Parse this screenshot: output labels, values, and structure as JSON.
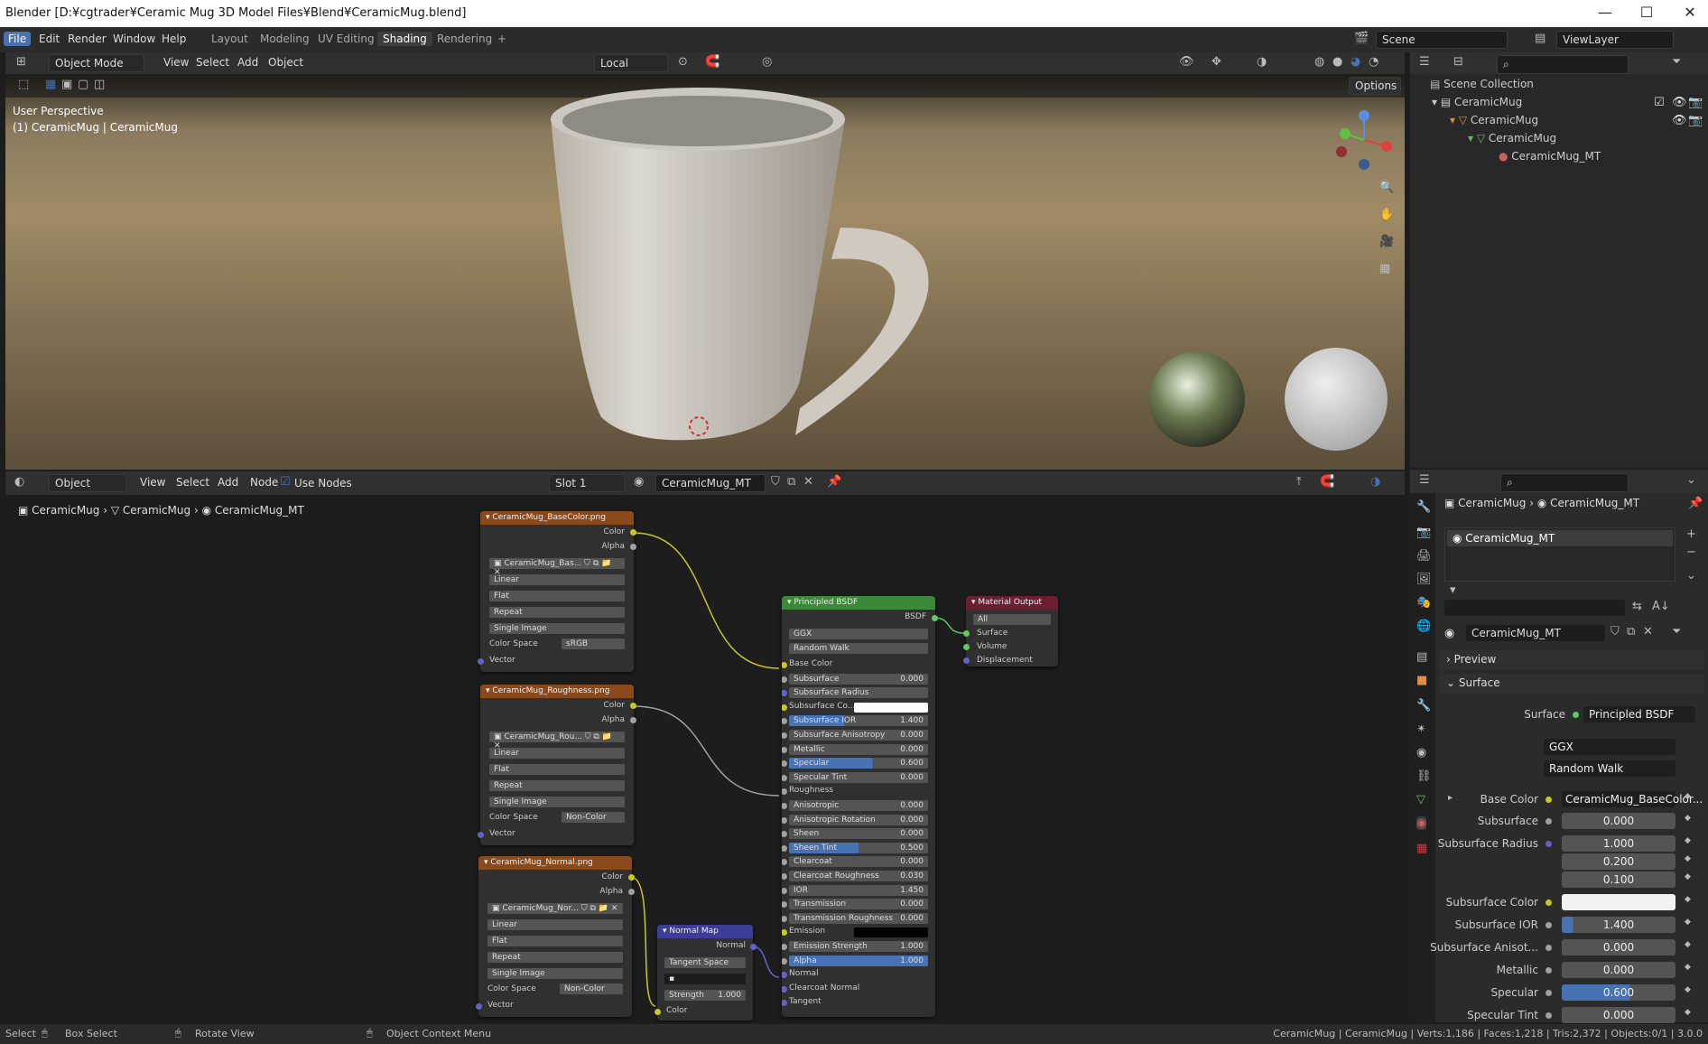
{
  "window": {
    "title": "Blender [D:¥cgtrader¥Ceramic Mug 3D Model Files¥Blend¥CeramicMug.blend]",
    "minimize": "—",
    "maximize": "☐",
    "close": "✕"
  },
  "menu": {
    "items": [
      "File",
      "Edit",
      "Render",
      "Window",
      "Help"
    ],
    "workspaces": [
      "Layout",
      "Modeling",
      "UV Editing",
      "Shading",
      "Rendering",
      "+"
    ],
    "scene": "Scene",
    "view_layer": "ViewLayer"
  },
  "viewport_header": {
    "mode": "Object Mode",
    "menus": [
      "View",
      "Select",
      "Add",
      "Object"
    ],
    "orientation": "Local",
    "options": "Options"
  },
  "viewport": {
    "perspective": "User Perspective",
    "object_info": "(1) CeramicMug | CeramicMug"
  },
  "outliner": {
    "title": "Scene Collection",
    "items": [
      "CeramicMug",
      "CeramicMug",
      "CeramicMug",
      "CeramicMug_MT"
    ]
  },
  "node_header": {
    "type": "Object",
    "menus": [
      "View",
      "Select",
      "Add",
      "Node"
    ],
    "use_nodes": "Use Nodes",
    "slot": "Slot 1",
    "material": "CeramicMug_MT"
  },
  "breadcrumb": [
    "CeramicMug",
    "CeramicMug",
    "CeramicMug_MT"
  ],
  "tex_nodes": [
    {
      "title": "CeramicMug_BaseColor.png",
      "image": "CeramicMug_Bas...",
      "interp": "Linear",
      "proj": "Flat",
      "ext": "Repeat",
      "src": "Single Image",
      "cs_label": "Color Space",
      "cs": "sRGB",
      "out1": "Color",
      "out2": "Alpha",
      "in": "Vector"
    },
    {
      "title": "CeramicMug_Roughness.png",
      "image": "CeramicMug_Rou...",
      "interp": "Linear",
      "proj": "Flat",
      "ext": "Repeat",
      "src": "Single Image",
      "cs_label": "Color Space",
      "cs": "Non-Color",
      "out1": "Color",
      "out2": "Alpha",
      "in": "Vector"
    },
    {
      "title": "CeramicMug_Normal.png",
      "image": "CeramicMug_Nor...",
      "interp": "Linear",
      "proj": "Flat",
      "ext": "Repeat",
      "src": "Single Image",
      "cs_label": "Color Space",
      "cs": "Non-Color",
      "out1": "Color",
      "out2": "Alpha",
      "in": "Vector"
    }
  ],
  "normal_map": {
    "title": "Normal Map",
    "out": "Normal",
    "space": "Tangent Space",
    "strength_label": "Strength",
    "strength": "1.000",
    "in": "Color"
  },
  "bsdf": {
    "title": "Principled BSDF",
    "out": "BSDF",
    "dist": "GGX",
    "sss": "Random Walk",
    "rows": [
      [
        "Base Color",
        ""
      ],
      [
        "Subsurface",
        "0.000"
      ],
      [
        "Subsurface Radius",
        ""
      ],
      [
        "Subsurface Co...",
        ""
      ],
      [
        "Subsurface IOR",
        "1.400"
      ],
      [
        "Subsurface Anisotropy",
        "0.000"
      ],
      [
        "Metallic",
        "0.000"
      ],
      [
        "Specular",
        "0.600"
      ],
      [
        "Specular Tint",
        "0.000"
      ],
      [
        "Roughness",
        ""
      ],
      [
        "Anisotropic",
        "0.000"
      ],
      [
        "Anisotropic Rotation",
        "0.000"
      ],
      [
        "Sheen",
        "0.000"
      ],
      [
        "Sheen Tint",
        "0.500"
      ],
      [
        "Clearcoat",
        "0.000"
      ],
      [
        "Clearcoat Roughness",
        "0.030"
      ],
      [
        "IOR",
        "1.450"
      ],
      [
        "Transmission",
        "0.000"
      ],
      [
        "Transmission Roughness",
        "0.000"
      ],
      [
        "Emission",
        ""
      ],
      [
        "Emission Strength",
        "1.000"
      ],
      [
        "Alpha",
        "1.000"
      ],
      [
        "Normal",
        ""
      ],
      [
        "Clearcoat Normal",
        ""
      ],
      [
        "Tangent",
        ""
      ]
    ]
  },
  "matout": {
    "title": "Material Output",
    "target": "All",
    "inputs": [
      "Surface",
      "Volume",
      "Displacement"
    ]
  },
  "props": {
    "breadcrumb1": "CeramicMug",
    "breadcrumb2": "CeramicMug_MT",
    "slot": "CeramicMug_MT",
    "material": "CeramicMug_MT",
    "preview": "Preview",
    "surface_panel": "Surface",
    "surface_label": "Surface",
    "surface_value": "Principled BSDF",
    "dist": "GGX",
    "sss": "Random Walk",
    "fields": [
      [
        "Base Color",
        "CeramicMug_BaseColor..."
      ],
      [
        "Subsurface",
        "0.000"
      ],
      [
        "Subsurface Radius",
        "1.000"
      ],
      [
        "",
        "0.200"
      ],
      [
        "",
        "0.100"
      ],
      [
        "Subsurface Color",
        ""
      ],
      [
        "Subsurface IOR",
        "1.400"
      ],
      [
        "Subsurface Anisot...",
        "0.000"
      ],
      [
        "Metallic",
        "0.000"
      ],
      [
        "Specular",
        "0.600"
      ],
      [
        "Specular Tint",
        "0.000"
      ]
    ]
  },
  "status": {
    "left": [
      "Select",
      "Box Select",
      "Rotate View",
      "Object Context Menu"
    ],
    "right": "CeramicMug | CeramicMug | Verts:1,186 | Faces:1,218 | Tris:2,372 | Objects:0/1 | 3.0.0"
  },
  "colors": {
    "accent": "#4772b3",
    "image_node": "#8a4a1c",
    "shader_node": "#3a8a3a",
    "vector_node": "#3c3c9a",
    "output_node": "#6a2030"
  }
}
